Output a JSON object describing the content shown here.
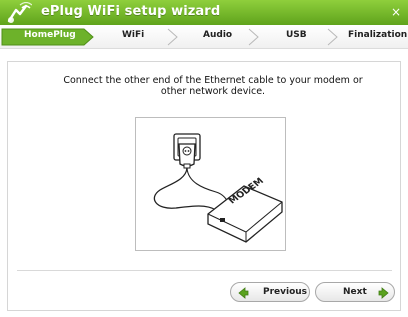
{
  "window": {
    "title": "ePlug WiFi setup wizard",
    "close_symbol": "×",
    "logo_icon": "eplug-wifi-logo-icon"
  },
  "steps": [
    {
      "label": "HomePlug",
      "active": true
    },
    {
      "label": "WiFi",
      "active": false
    },
    {
      "label": "Audio",
      "active": false
    },
    {
      "label": "USB",
      "active": false
    },
    {
      "label": "Finalization",
      "active": false
    }
  ],
  "content": {
    "instruction_line1": "Connect the other end of the Ethernet cable to your modem or",
    "instruction_line2": "other network device.",
    "illustration_text": "MODEM"
  },
  "buttons": {
    "previous": "Previous",
    "next": "Next"
  },
  "colors": {
    "brand_green": "#6db22a",
    "active_step": "#6db22a",
    "arrow_green": "#5aa21e"
  }
}
